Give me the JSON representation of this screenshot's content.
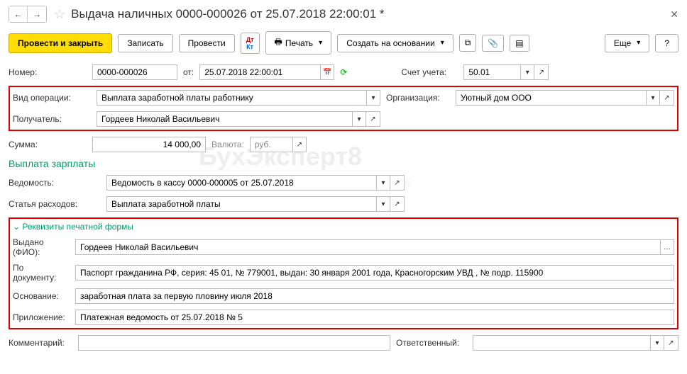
{
  "header": {
    "title": "Выдача наличных 0000-000026 от 25.07.2018 22:00:01 *"
  },
  "toolbar": {
    "post_close": "Провести и закрыть",
    "record": "Записать",
    "post": "Провести",
    "print": "Печать",
    "create_based": "Создать на основании",
    "more": "Еще",
    "help": "?"
  },
  "fields": {
    "number_label": "Номер:",
    "number": "0000-000026",
    "from_label": "от:",
    "date": "25.07.2018 22:00:01",
    "account_label": "Счет учета:",
    "account": "50.01",
    "op_type_label": "Вид операции:",
    "op_type": "Выплата заработной платы работнику",
    "org_label": "Организация:",
    "org": "Уютный дом ООО",
    "recipient_label": "Получатель:",
    "recipient": "Гордеев Николай Васильевич",
    "sum_label": "Сумма:",
    "sum": "14 000,00",
    "currency_label": "Валюта:",
    "currency": "руб.",
    "salary_section": "Выплата зарплаты",
    "vedomost_label": "Ведомость:",
    "vedomost": "Ведомость в кассу 0000-000005 от 25.07.2018",
    "expense_label": "Статья расходов:",
    "expense": "Выплата заработной платы",
    "print_req": "Реквизиты печатной формы",
    "issued_label": "Выдано (ФИО):",
    "issued": "Гордеев Николай Васильевич",
    "doc_label": "По документу:",
    "doc": "Паспорт гражданина РФ, серия: 45 01, № 779001, выдан: 30 января 2001 года, Красногорским УВД , № подр. 115900",
    "basis_label": "Основание:",
    "basis": "заработная плата за первую пловину июля 2018",
    "attach_label": "Приложение:",
    "attach": "Платежная ведомость от 25.07.2018 № 5",
    "comment_label": "Комментарий:",
    "responsible_label": "Ответственный:"
  },
  "watermark": {
    "main": "БухЭксперт8",
    "sub": "База ответов по учёту в 1С"
  }
}
